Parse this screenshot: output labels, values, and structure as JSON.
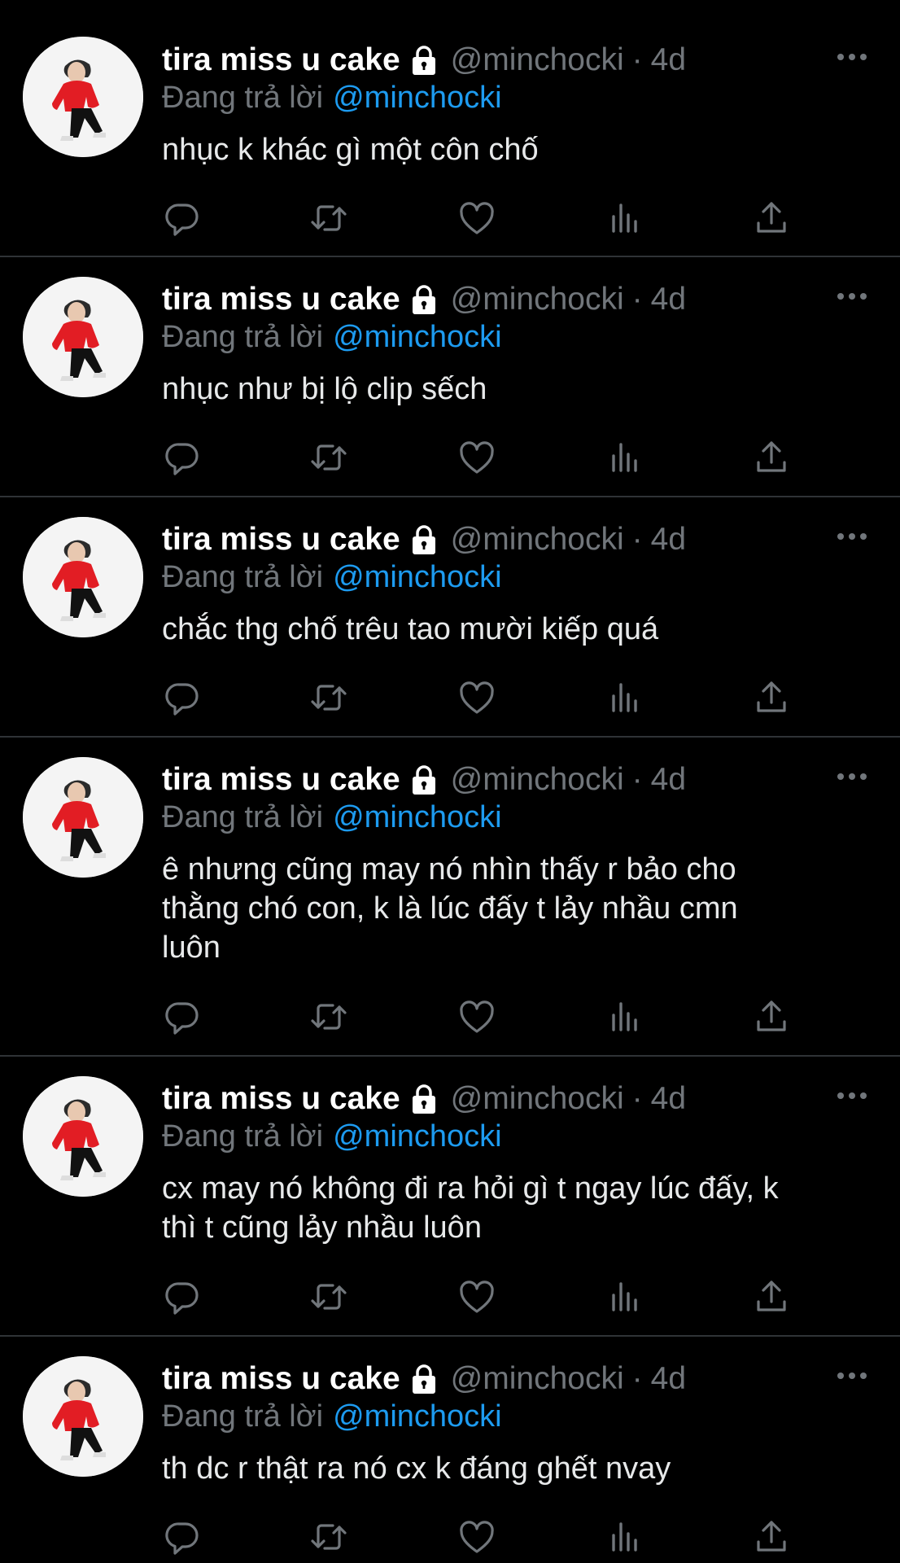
{
  "theme": {
    "background": "#000000",
    "text": "#e7e9ea",
    "secondary": "#71767b",
    "link": "#1d9bf0",
    "divider": "#2f3336"
  },
  "tweets": [
    {
      "name": "tira miss u cake",
      "handle": "@minchocki",
      "sep": "·",
      "time": "4d",
      "reply_prefix": "Đang trả lời",
      "reply_to": "@minchocki",
      "text": "nhục k khác gì một côn chố"
    },
    {
      "name": "tira miss u cake",
      "handle": "@minchocki",
      "sep": "·",
      "time": "4d",
      "reply_prefix": "Đang trả lời",
      "reply_to": "@minchocki",
      "text": "nhục như bị lộ clip sếch"
    },
    {
      "name": "tira miss u cake",
      "handle": "@minchocki",
      "sep": "·",
      "time": "4d",
      "reply_prefix": "Đang trả lời",
      "reply_to": "@minchocki",
      "text": "chắc thg chố trêu tao mười kiếp quá"
    },
    {
      "name": "tira miss u cake",
      "handle": "@minchocki",
      "sep": "·",
      "time": "4d",
      "reply_prefix": "Đang trả lời",
      "reply_to": "@minchocki",
      "text": "ê nhưng cũng may nó nhìn thấy r bảo cho\nthằng chó con, k là lúc đấy t lảy nhầu cmn\nluôn"
    },
    {
      "name": "tira miss u cake",
      "handle": "@minchocki",
      "sep": "·",
      "time": "4d",
      "reply_prefix": "Đang trả lời",
      "reply_to": "@minchocki",
      "text": "cx may nó không đi ra hỏi gì t ngay lúc đấy, k\nthì t cũng lảy nhầu luôn"
    },
    {
      "name": "tira miss u cake",
      "handle": "@minchocki",
      "sep": "·",
      "time": "4d",
      "reply_prefix": "Đang trả lời",
      "reply_to": "@minchocki",
      "text": "th dc r thật ra nó cx k đáng ghết nvay"
    }
  ],
  "icons": {
    "lock": "lock-icon",
    "more": "more-icon",
    "reply": "reply-icon",
    "retweet": "retweet-icon",
    "like": "like-icon",
    "views": "views-icon",
    "share": "share-icon"
  }
}
